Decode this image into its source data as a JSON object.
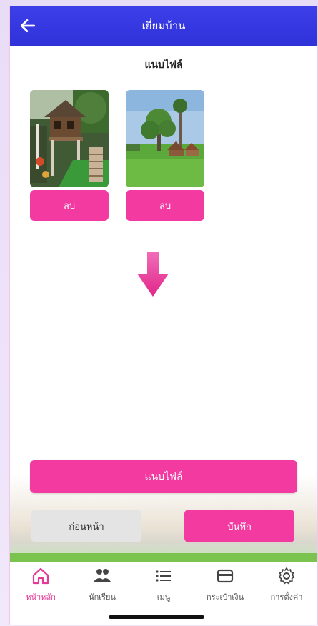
{
  "header": {
    "title": "เยี่ยมบ้าน",
    "back_icon": "arrow-left-icon"
  },
  "section": {
    "subtitle": "แนบไฟล์"
  },
  "photos": [
    {
      "delete_label": "ลบ",
      "scene": "wooden stilt house with garden"
    },
    {
      "delete_label": "ลบ",
      "scene": "houses among green rice field"
    }
  ],
  "arrow_icon": "arrow-down-icon",
  "actions": {
    "attach_label": "แนบไฟล์",
    "prev_label": "ก่อนหน้า",
    "save_label": "บันทึก"
  },
  "colors": {
    "accent": "#f23aa0",
    "header": "#3537e0",
    "active_nav": "#e23a95"
  },
  "nav": {
    "items": [
      {
        "label": "หน้าหลัก",
        "icon": "home-icon",
        "active": true
      },
      {
        "label": "นักเรียน",
        "icon": "students-icon",
        "active": false
      },
      {
        "label": "เมนู",
        "icon": "menu-icon",
        "active": false
      },
      {
        "label": "กระเป๋าเงิน",
        "icon": "wallet-icon",
        "active": false
      },
      {
        "label": "การตั้งค่า",
        "icon": "gear-icon",
        "active": false
      }
    ]
  }
}
